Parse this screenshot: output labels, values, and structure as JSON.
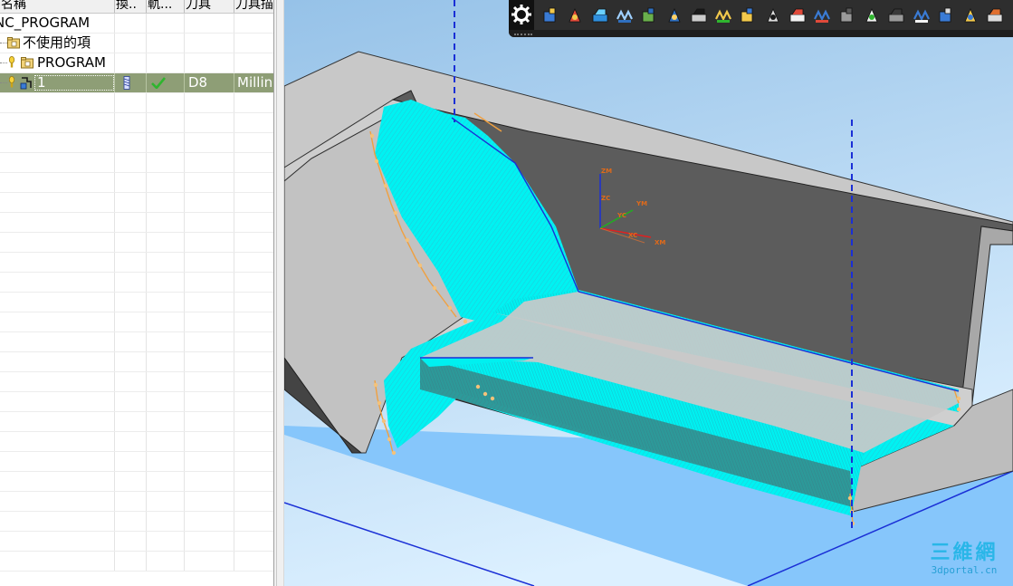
{
  "navigator": {
    "columns": [
      "名稱",
      "換..",
      "軌...",
      "刀具",
      "刀具描述"
    ],
    "rows": [
      {
        "name": "NC_PROGRAM",
        "type": "root"
      },
      {
        "name": "不使用的項",
        "type": "folder"
      },
      {
        "name": "PROGRAM",
        "type": "program"
      },
      {
        "name": "1",
        "type": "operation",
        "selected": true,
        "tool": "D8",
        "description": "Milling",
        "toolchange_icon": "tool-change-icon",
        "path_status_icon": "check-icon"
      }
    ]
  },
  "toolbar": {
    "buttons": [
      "settings-gear",
      "create-program",
      "create-tool",
      "create-geometry",
      "create-method",
      "create-operation",
      "generate-toolpath",
      "replay-toolpath",
      "list-toolpath",
      "verify-toolpath",
      "simulate-machine",
      "post-process",
      "shop-documentation",
      "output-cls",
      "transform-object",
      "display-part",
      "collision-check",
      "show-2d-view",
      "measure-toolpath",
      "feeds-speeds"
    ]
  },
  "viewport": {
    "csys_labels": [
      "ZM",
      "ZC",
      "YM",
      "YC",
      "XC",
      "XM"
    ],
    "colors": {
      "background_top": "#9cc6e8",
      "background_bottom": "#d8ecfa",
      "part_gray": "#c4c4c4",
      "part_dark": "#5d5d5d",
      "floor_blue": "#86c6fb",
      "toolpath_cyan": "#00f0f0",
      "engage_orange": "#f0a040",
      "tool_axis_blue": "#1a2fd6"
    }
  },
  "watermark": {
    "logo": "三維網",
    "site": "3dportal.cn"
  }
}
